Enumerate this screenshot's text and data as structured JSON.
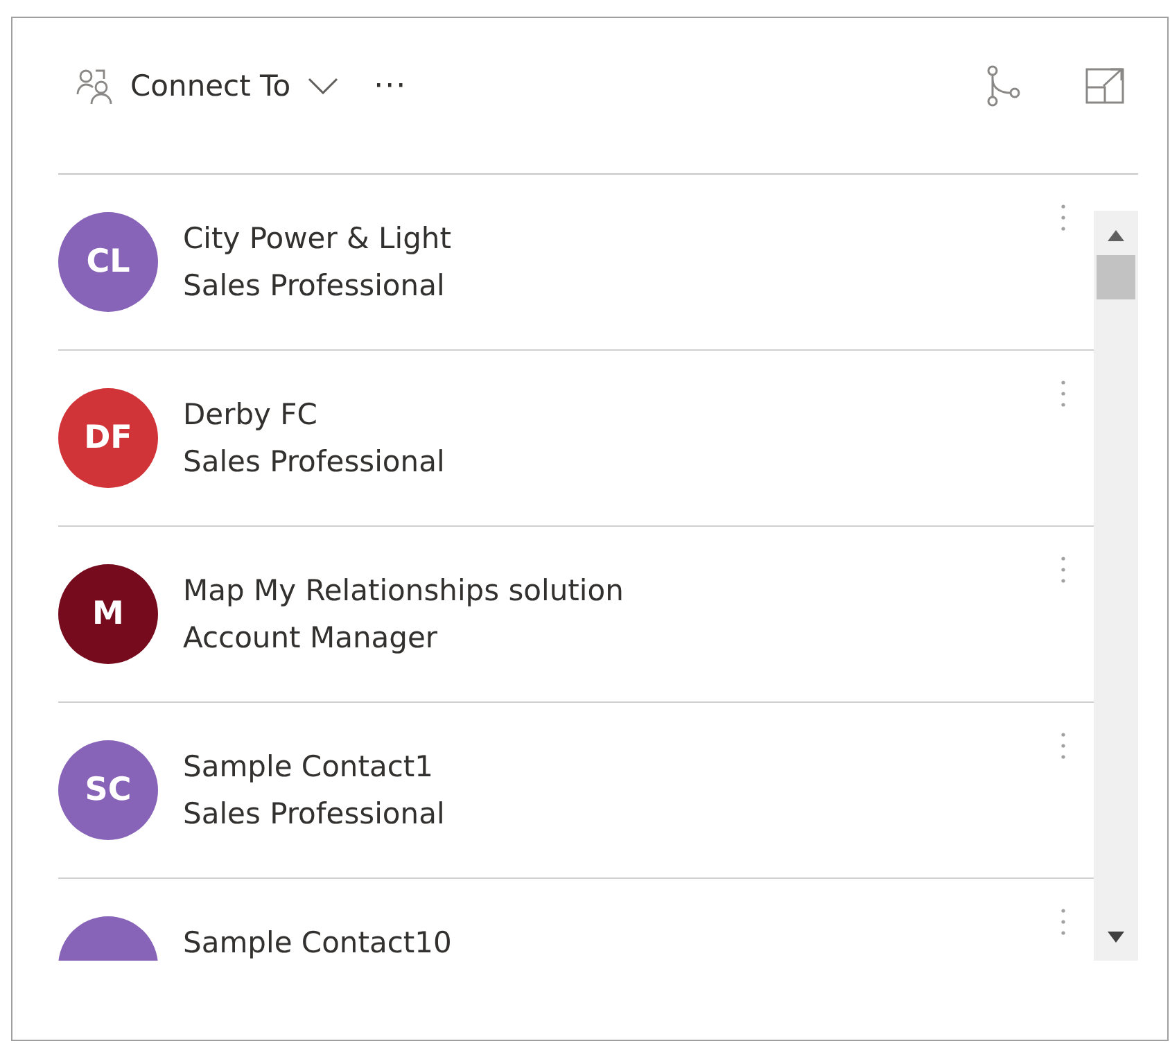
{
  "toolbar": {
    "connect_label": "Connect To",
    "more": "···"
  },
  "contacts": [
    {
      "initials": "CL",
      "name": "City Power & Light",
      "role": "Sales Professional",
      "color": "#8764b8"
    },
    {
      "initials": "DF",
      "name": "Derby FC",
      "role": "Sales Professional",
      "color": "#d13438"
    },
    {
      "initials": "M",
      "name": "Map My Relationships solution",
      "role": "Account Manager",
      "color": "#750b1c"
    },
    {
      "initials": "SC",
      "name": "Sample Contact1",
      "role": "Sales Professional",
      "color": "#8764b8"
    },
    {
      "name": "Sample Contact10",
      "color": "#8764b8"
    }
  ]
}
